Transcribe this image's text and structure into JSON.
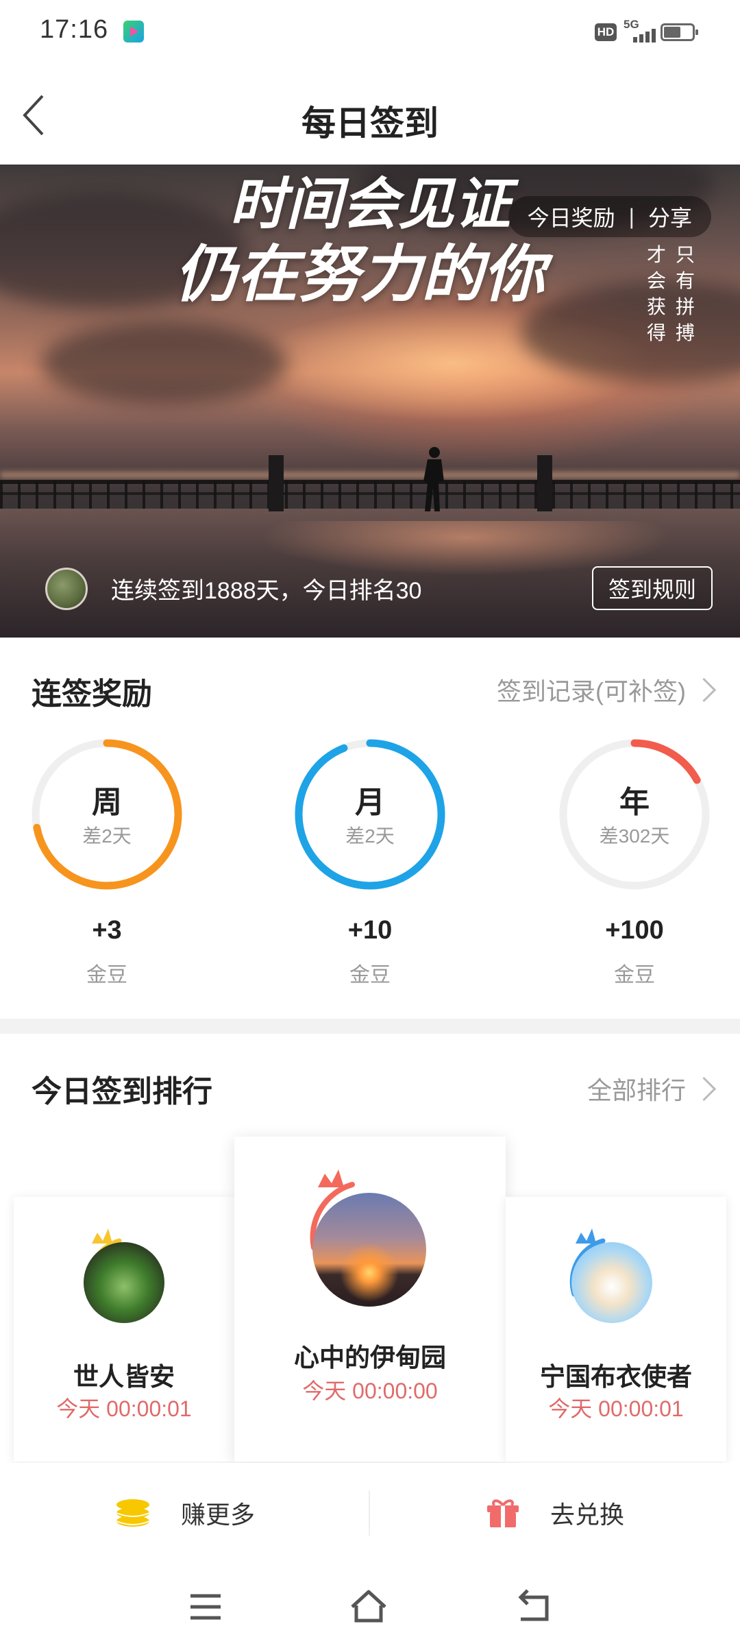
{
  "status_bar": {
    "time": "17:16",
    "hd": "HD",
    "network": "5G"
  },
  "header": {
    "title": "每日签到"
  },
  "banner": {
    "slogan_line1": "时间会见证",
    "slogan_line2": "仍在努力的你",
    "side_col1": [
      "只",
      "有",
      "拼",
      "搏"
    ],
    "side_col2": [
      "才",
      "会",
      "获",
      "得"
    ],
    "today_reward": "今日奖励",
    "separator": "|",
    "share": "分享",
    "streak_text": "连续签到1888天，今日排名30",
    "rules_button": "签到规则"
  },
  "streak_rewards": {
    "title": "连签奖励",
    "link": "签到记录(可补签)",
    "items": [
      {
        "period": "周",
        "remaining": "差2天",
        "reward": "+3",
        "unit": "金豆",
        "progress": 0.72,
        "color": "#f7941d"
      },
      {
        "period": "月",
        "remaining": "差2天",
        "reward": "+10",
        "unit": "金豆",
        "progress": 0.94,
        "color": "#1ea3e6"
      },
      {
        "period": "年",
        "remaining": "差302天",
        "reward": "+100",
        "unit": "金豆",
        "progress": 0.17,
        "color": "#f25c4d"
      }
    ]
  },
  "ranking": {
    "title": "今日签到排行",
    "link": "全部排行",
    "entries": [
      {
        "name": "心中的伊甸园",
        "time": "今天 00:00:00",
        "crown_color": "#f36a5c"
      },
      {
        "name": "世人皆安",
        "time": "今天 00:00:01",
        "crown_color": "#f7c52d"
      },
      {
        "name": "宁国布衣使者",
        "time": "今天 00:00:01",
        "crown_color": "#3d9be9"
      }
    ]
  },
  "actions": {
    "earn_more": "赚更多",
    "redeem": "去兑换"
  },
  "colors": {
    "accent_red": "#e06a6a",
    "coin_yellow": "#f7c800",
    "gift_red": "#f16b6b"
  }
}
